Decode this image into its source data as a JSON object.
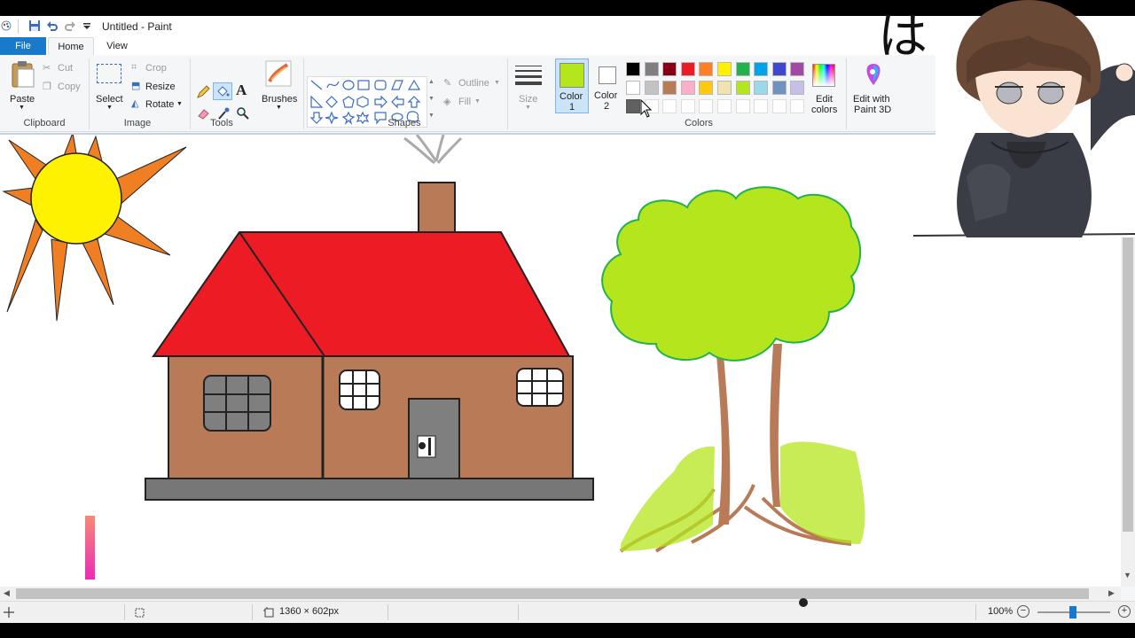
{
  "window": {
    "title": "Untitled - Paint"
  },
  "tabs": {
    "file": "File",
    "home": "Home",
    "view": "View"
  },
  "clipboard": {
    "paste": "Paste",
    "cut": "Cut",
    "copy": "Copy",
    "label": "Clipboard"
  },
  "image": {
    "select": "Select",
    "crop": "Crop",
    "resize": "Resize",
    "rotate": "Rotate",
    "label": "Image"
  },
  "tools": {
    "text_tool": "A",
    "brushes": "Brushes",
    "label": "Tools"
  },
  "shapes": {
    "outline": "Outline",
    "fill": "Fill",
    "label": "Shapes"
  },
  "size": {
    "label": "Size"
  },
  "colors": {
    "color1_line1": "Color",
    "color1_line2": "1",
    "color2_line1": "Color",
    "color2_line2": "2",
    "edit_colors_line1": "Edit",
    "edit_colors_line2": "colors",
    "edit_paint3d_line1": "Edit with",
    "edit_paint3d_line2": "Paint 3D",
    "label": "Colors",
    "color1_value": "#b5e61d",
    "color2_value": "#ffffff",
    "palette_row1": [
      "#000000",
      "#7f7f7f",
      "#880015",
      "#ed1c24",
      "#ff7f27",
      "#fff200",
      "#22b14c",
      "#00a2e8",
      "#3f48cc",
      "#a349a4"
    ],
    "palette_row2": [
      "#ffffff",
      "#c3c3c3",
      "#b97a57",
      "#ffaec9",
      "#ffc90e",
      "#efe4b0",
      "#b5e61d",
      "#99d9ea",
      "#7092be",
      "#c8bfe7"
    ],
    "palette_row3_first": "#606060"
  },
  "status": {
    "dimensions": "1360 × 602px",
    "zoom": "100%"
  },
  "overlay_text": "は"
}
